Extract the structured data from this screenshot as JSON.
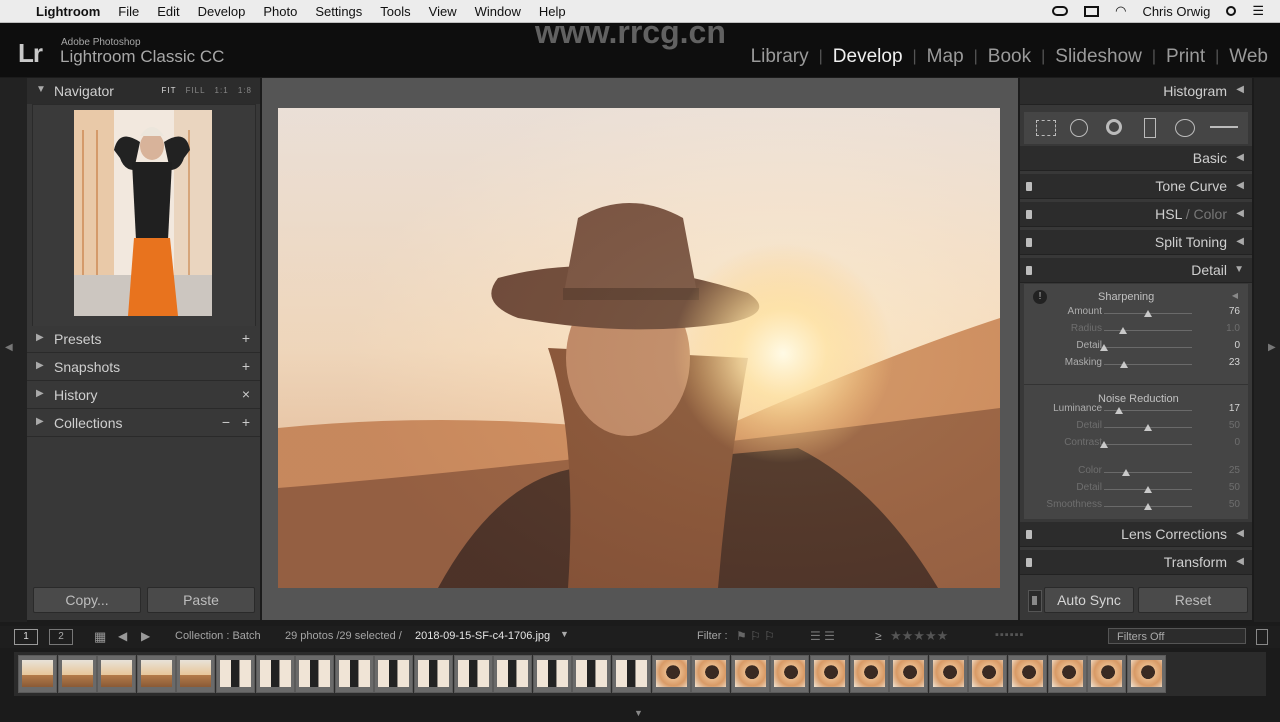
{
  "menubar": {
    "app_name": "Lightroom",
    "items": [
      "File",
      "Edit",
      "Develop",
      "Photo",
      "Settings",
      "Tools",
      "View",
      "Window",
      "Help"
    ],
    "user": "Chris Orwig"
  },
  "header": {
    "logo": "Lr",
    "product_line1": "Adobe Photoshop",
    "product_line2": "Lightroom Classic CC",
    "modules": [
      "Library",
      "Develop",
      "Map",
      "Book",
      "Slideshow",
      "Print",
      "Web"
    ],
    "active_module": "Develop"
  },
  "watermark": "www.rrcg.cn",
  "left_panel": {
    "navigator_label": "Navigator",
    "zoom_options": [
      "FIT",
      "FILL",
      "1:1",
      "1:8"
    ],
    "presets_label": "Presets",
    "snapshots_label": "Snapshots",
    "history_label": "History",
    "collections_label": "Collections",
    "copy_button": "Copy...",
    "paste_button": "Paste"
  },
  "right_panel": {
    "histogram_label": "Histogram",
    "basic_label": "Basic",
    "tone_curve_label": "Tone Curve",
    "hsl_label": "HSL",
    "hsl_sep": " / ",
    "color_label": "Color",
    "split_toning_label": "Split Toning",
    "detail_label": "Detail",
    "sharpening_label": "Sharpening",
    "sharpening": [
      {
        "label": "Amount",
        "value": "76",
        "pos": 0.5
      },
      {
        "label": "Radius",
        "value": "1.0",
        "pos": 0.22,
        "dim": true
      },
      {
        "label": "Detail",
        "value": "0",
        "pos": 0.0
      },
      {
        "label": "Masking",
        "value": "23",
        "pos": 0.23
      }
    ],
    "noise_reduction_label": "Noise Reduction",
    "noise": [
      {
        "label": "Luminance",
        "value": "17",
        "pos": 0.17
      },
      {
        "label": "Detail",
        "value": "50",
        "pos": 0.5,
        "dim": true
      },
      {
        "label": "Contrast",
        "value": "0",
        "pos": 0.0,
        "dim": true
      }
    ],
    "color_noise": [
      {
        "label": "Color",
        "value": "25",
        "pos": 0.25,
        "dim": true
      },
      {
        "label": "Detail",
        "value": "50",
        "pos": 0.5,
        "dim": true
      },
      {
        "label": "Smoothness",
        "value": "50",
        "pos": 0.5,
        "dim": true
      }
    ],
    "lens_corrections_label": "Lens Corrections",
    "transform_label": "Transform",
    "auto_sync_button": "Auto Sync",
    "reset_button": "Reset"
  },
  "filmstrip_bar": {
    "view1": "1",
    "view2": "2",
    "source": "Collection : Batch",
    "count": "29 photos /29 selected /",
    "filename": "2018-09-15-SF-c4-1706.jpg",
    "filter_label": "Filter :",
    "rating_op": "≥",
    "filters_off": "Filters Off"
  },
  "filmstrip": {
    "thumb_count": 29,
    "thumb_kinds": [
      "land",
      "land",
      "land",
      "land",
      "land",
      "port",
      "port",
      "port",
      "port",
      "port",
      "port",
      "port",
      "port",
      "port",
      "port",
      "port",
      "hat",
      "hat",
      "hat",
      "hat",
      "hat",
      "hat",
      "hat",
      "hat",
      "hat",
      "hat",
      "hat",
      "hat",
      "hat"
    ]
  },
  "colors": {
    "accent": "#f0f0f0",
    "panel": "#383838",
    "canvas": "#555555"
  }
}
